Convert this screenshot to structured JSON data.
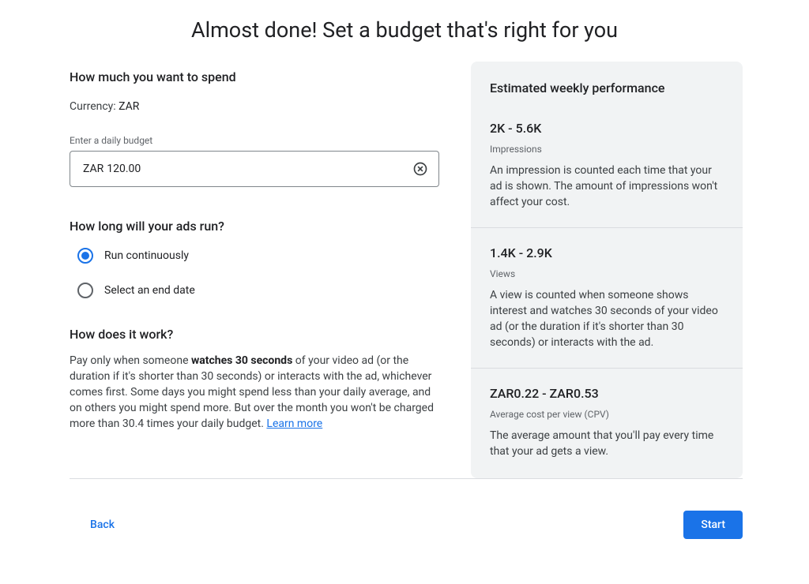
{
  "title": "Almost done! Set a budget that's right for you",
  "spend": {
    "heading": "How much you want to spend",
    "currency_prefix": "Currency: ",
    "currency_code": "ZAR",
    "field_label": "Enter a daily budget",
    "input_prefix": "ZAR",
    "input_value": "120.00"
  },
  "duration": {
    "heading": "How long will your ads run?",
    "options": [
      {
        "label": "Run continuously",
        "selected": true
      },
      {
        "label": "Select an end date",
        "selected": false
      }
    ]
  },
  "how": {
    "heading": "How does it work?",
    "text_before": "Pay only when someone ",
    "text_bold": "watches 30 seconds",
    "text_after": " of your video ad (or the duration if it's shorter than 30 seconds) or interacts with the ad, whichever comes first. Some days you might spend less than your daily average, and on others you might spend more. But over the month you won't be charged more than 30.4 times your daily budget. ",
    "learn_more": "Learn more"
  },
  "estimate": {
    "title": "Estimated weekly performance",
    "metrics": [
      {
        "value": "2K - 5.6K",
        "label": "Impressions",
        "desc": "An impression is counted each time that your ad is shown. The amount of impressions won't affect your cost."
      },
      {
        "value": "1.4K - 2.9K",
        "label": "Views",
        "desc": "A view is counted when someone shows interest and watches 30 seconds of your video ad (or the duration if it's shorter than 30 seconds) or interacts with the ad."
      },
      {
        "value": "ZAR0.22 - ZAR0.53",
        "label": "Average cost per view (CPV)",
        "desc": "The average amount that you'll pay every time that your ad gets a view."
      }
    ]
  },
  "footer": {
    "back": "Back",
    "start": "Start"
  }
}
